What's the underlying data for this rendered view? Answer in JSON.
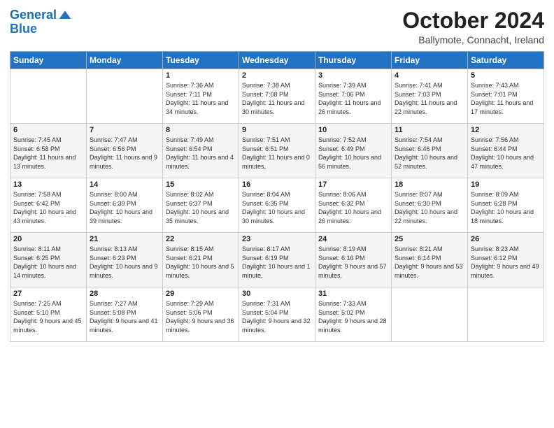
{
  "logo": {
    "line1": "General",
    "line2": "Blue"
  },
  "title": "October 2024",
  "location": "Ballymote, Connacht, Ireland",
  "days_of_week": [
    "Sunday",
    "Monday",
    "Tuesday",
    "Wednesday",
    "Thursday",
    "Friday",
    "Saturday"
  ],
  "weeks": [
    [
      {
        "day": "",
        "sunrise": "",
        "sunset": "",
        "daylight": ""
      },
      {
        "day": "",
        "sunrise": "",
        "sunset": "",
        "daylight": ""
      },
      {
        "day": "1",
        "sunrise": "Sunrise: 7:36 AM",
        "sunset": "Sunset: 7:11 PM",
        "daylight": "Daylight: 11 hours and 34 minutes."
      },
      {
        "day": "2",
        "sunrise": "Sunrise: 7:38 AM",
        "sunset": "Sunset: 7:08 PM",
        "daylight": "Daylight: 11 hours and 30 minutes."
      },
      {
        "day": "3",
        "sunrise": "Sunrise: 7:39 AM",
        "sunset": "Sunset: 7:06 PM",
        "daylight": "Daylight: 11 hours and 26 minutes."
      },
      {
        "day": "4",
        "sunrise": "Sunrise: 7:41 AM",
        "sunset": "Sunset: 7:03 PM",
        "daylight": "Daylight: 11 hours and 22 minutes."
      },
      {
        "day": "5",
        "sunrise": "Sunrise: 7:43 AM",
        "sunset": "Sunset: 7:01 PM",
        "daylight": "Daylight: 11 hours and 17 minutes."
      }
    ],
    [
      {
        "day": "6",
        "sunrise": "Sunrise: 7:45 AM",
        "sunset": "Sunset: 6:58 PM",
        "daylight": "Daylight: 11 hours and 13 minutes."
      },
      {
        "day": "7",
        "sunrise": "Sunrise: 7:47 AM",
        "sunset": "Sunset: 6:56 PM",
        "daylight": "Daylight: 11 hours and 9 minutes."
      },
      {
        "day": "8",
        "sunrise": "Sunrise: 7:49 AM",
        "sunset": "Sunset: 6:54 PM",
        "daylight": "Daylight: 11 hours and 4 minutes."
      },
      {
        "day": "9",
        "sunrise": "Sunrise: 7:51 AM",
        "sunset": "Sunset: 6:51 PM",
        "daylight": "Daylight: 11 hours and 0 minutes."
      },
      {
        "day": "10",
        "sunrise": "Sunrise: 7:52 AM",
        "sunset": "Sunset: 6:49 PM",
        "daylight": "Daylight: 10 hours and 56 minutes."
      },
      {
        "day": "11",
        "sunrise": "Sunrise: 7:54 AM",
        "sunset": "Sunset: 6:46 PM",
        "daylight": "Daylight: 10 hours and 52 minutes."
      },
      {
        "day": "12",
        "sunrise": "Sunrise: 7:56 AM",
        "sunset": "Sunset: 6:44 PM",
        "daylight": "Daylight: 10 hours and 47 minutes."
      }
    ],
    [
      {
        "day": "13",
        "sunrise": "Sunrise: 7:58 AM",
        "sunset": "Sunset: 6:42 PM",
        "daylight": "Daylight: 10 hours and 43 minutes."
      },
      {
        "day": "14",
        "sunrise": "Sunrise: 8:00 AM",
        "sunset": "Sunset: 6:39 PM",
        "daylight": "Daylight: 10 hours and 39 minutes."
      },
      {
        "day": "15",
        "sunrise": "Sunrise: 8:02 AM",
        "sunset": "Sunset: 6:37 PM",
        "daylight": "Daylight: 10 hours and 35 minutes."
      },
      {
        "day": "16",
        "sunrise": "Sunrise: 8:04 AM",
        "sunset": "Sunset: 6:35 PM",
        "daylight": "Daylight: 10 hours and 30 minutes."
      },
      {
        "day": "17",
        "sunrise": "Sunrise: 8:06 AM",
        "sunset": "Sunset: 6:32 PM",
        "daylight": "Daylight: 10 hours and 26 minutes."
      },
      {
        "day": "18",
        "sunrise": "Sunrise: 8:07 AM",
        "sunset": "Sunset: 6:30 PM",
        "daylight": "Daylight: 10 hours and 22 minutes."
      },
      {
        "day": "19",
        "sunrise": "Sunrise: 8:09 AM",
        "sunset": "Sunset: 6:28 PM",
        "daylight": "Daylight: 10 hours and 18 minutes."
      }
    ],
    [
      {
        "day": "20",
        "sunrise": "Sunrise: 8:11 AM",
        "sunset": "Sunset: 6:25 PM",
        "daylight": "Daylight: 10 hours and 14 minutes."
      },
      {
        "day": "21",
        "sunrise": "Sunrise: 8:13 AM",
        "sunset": "Sunset: 6:23 PM",
        "daylight": "Daylight: 10 hours and 9 minutes."
      },
      {
        "day": "22",
        "sunrise": "Sunrise: 8:15 AM",
        "sunset": "Sunset: 6:21 PM",
        "daylight": "Daylight: 10 hours and 5 minutes."
      },
      {
        "day": "23",
        "sunrise": "Sunrise: 8:17 AM",
        "sunset": "Sunset: 6:19 PM",
        "daylight": "Daylight: 10 hours and 1 minute."
      },
      {
        "day": "24",
        "sunrise": "Sunrise: 8:19 AM",
        "sunset": "Sunset: 6:16 PM",
        "daylight": "Daylight: 9 hours and 57 minutes."
      },
      {
        "day": "25",
        "sunrise": "Sunrise: 8:21 AM",
        "sunset": "Sunset: 6:14 PM",
        "daylight": "Daylight: 9 hours and 53 minutes."
      },
      {
        "day": "26",
        "sunrise": "Sunrise: 8:23 AM",
        "sunset": "Sunset: 6:12 PM",
        "daylight": "Daylight: 9 hours and 49 minutes."
      }
    ],
    [
      {
        "day": "27",
        "sunrise": "Sunrise: 7:25 AM",
        "sunset": "Sunset: 5:10 PM",
        "daylight": "Daylight: 9 hours and 45 minutes."
      },
      {
        "day": "28",
        "sunrise": "Sunrise: 7:27 AM",
        "sunset": "Sunset: 5:08 PM",
        "daylight": "Daylight: 9 hours and 41 minutes."
      },
      {
        "day": "29",
        "sunrise": "Sunrise: 7:29 AM",
        "sunset": "Sunset: 5:06 PM",
        "daylight": "Daylight: 9 hours and 36 minutes."
      },
      {
        "day": "30",
        "sunrise": "Sunrise: 7:31 AM",
        "sunset": "Sunset: 5:04 PM",
        "daylight": "Daylight: 9 hours and 32 minutes."
      },
      {
        "day": "31",
        "sunrise": "Sunrise: 7:33 AM",
        "sunset": "Sunset: 5:02 PM",
        "daylight": "Daylight: 9 hours and 28 minutes."
      },
      {
        "day": "",
        "sunrise": "",
        "sunset": "",
        "daylight": ""
      },
      {
        "day": "",
        "sunrise": "",
        "sunset": "",
        "daylight": ""
      }
    ]
  ]
}
